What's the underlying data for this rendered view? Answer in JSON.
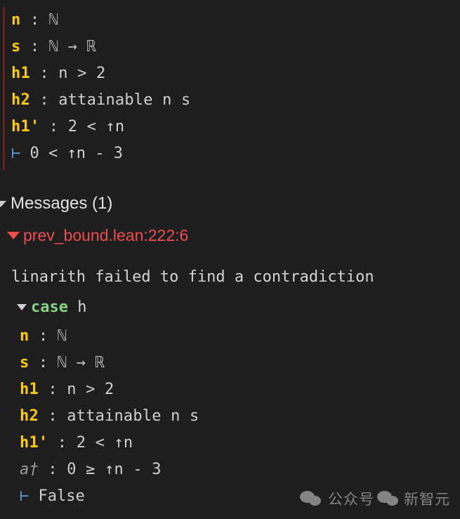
{
  "theme": {
    "background": "#1e1e1e",
    "foreground": "#cccccc",
    "hypothesis_name": "#ffcc00",
    "anonymous_name": "#9b9b9b",
    "turnstile": "#5a9ddb",
    "error": "#f14c4c",
    "keyword": "#89d185",
    "stripe": "#6b2020"
  },
  "goal_pane": {
    "name": "tactic-goal-state",
    "hypotheses": [
      {
        "name": "n",
        "sep": " : ",
        "type": "ℕ"
      },
      {
        "name": "s",
        "sep": " : ",
        "type": "ℕ → ℝ"
      },
      {
        "name": "h1",
        "sep": " : ",
        "type": "n > 2"
      },
      {
        "name": "h2",
        "sep": " : ",
        "type": "attainable n s"
      },
      {
        "name": "h1'",
        "sep": " : ",
        "type": "2 < ↑n"
      }
    ],
    "goal_symbol": "⊢",
    "goal": "0 < ↑n - 3"
  },
  "messages": {
    "toggle_icon": "triangle-down-icon",
    "title": "Messages (1)",
    "count": 1,
    "entries": [
      {
        "toggle_icon": "triangle-down-icon",
        "severity": "error",
        "location": "prev_bound.lean:222:6",
        "text": "linarith failed to find a contradiction",
        "case": {
          "toggle_icon": "triangle-down-icon",
          "keyword": "case",
          "name": "h"
        },
        "hypotheses": [
          {
            "name": "n",
            "sep": " : ",
            "type": "ℕ",
            "anonymous": false
          },
          {
            "name": "s",
            "sep": " : ",
            "type": "ℕ → ℝ",
            "anonymous": false
          },
          {
            "name": "h1",
            "sep": " : ",
            "type": "n > 2",
            "anonymous": false
          },
          {
            "name": "h2",
            "sep": " : ",
            "type": "attainable n s",
            "anonymous": false
          },
          {
            "name": "h1'",
            "sep": " : ",
            "type": "2 < ↑n",
            "anonymous": false
          },
          {
            "name": "a†",
            "sep": " : ",
            "type": "0 ≥ ↑n - 3",
            "anonymous": true
          }
        ],
        "goal_symbol": "⊢",
        "goal": "False"
      }
    ]
  },
  "watermark": {
    "prefix": "公众号",
    "icon": "wechat-icon",
    "suffix": "新智元"
  }
}
